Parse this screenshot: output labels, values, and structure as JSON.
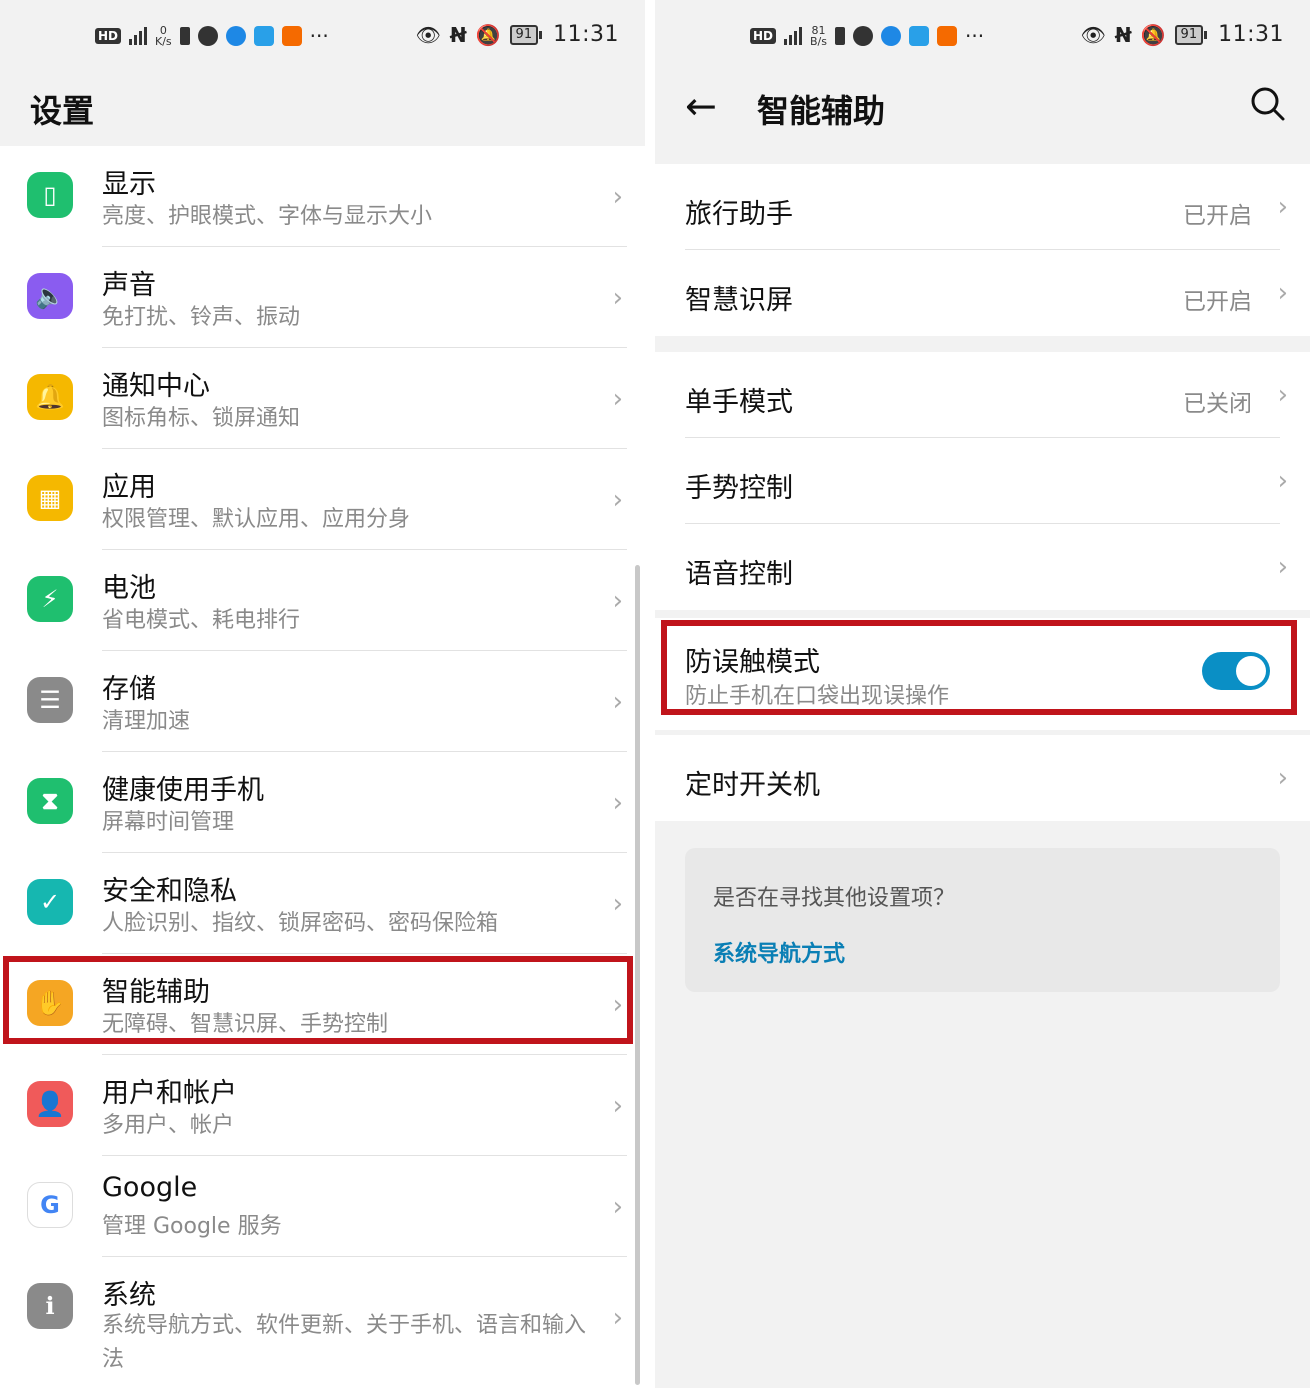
{
  "colors": {
    "accent": "#0a8fc5",
    "highlight": "#c0141b"
  },
  "left": {
    "status": {
      "hd": "HD",
      "net_speed": "0",
      "net_unit": "K/s",
      "battery": "91",
      "time": "11:31"
    },
    "title": "设置",
    "items": [
      {
        "label": "显示",
        "sub": "亮度、护眼模式、字体与显示大小",
        "icon": "display-icon",
        "color": "#1fbf6f"
      },
      {
        "label": "声音",
        "sub": "免打扰、铃声、振动",
        "icon": "speaker-icon",
        "color": "#8a5cf0"
      },
      {
        "label": "通知中心",
        "sub": "图标角标、锁屏通知",
        "icon": "bell-icon",
        "color": "#f5b800"
      },
      {
        "label": "应用",
        "sub": "权限管理、默认应用、应用分身",
        "icon": "apps-grid-icon",
        "color": "#f5b800"
      },
      {
        "label": "电池",
        "sub": "省电模式、耗电排行",
        "icon": "battery-icon",
        "color": "#1fbf6f"
      },
      {
        "label": "存储",
        "sub": "清理加速",
        "icon": "storage-icon",
        "color": "#8a8a8a"
      },
      {
        "label": "健康使用手机",
        "sub": "屏幕时间管理",
        "icon": "hourglass-icon",
        "color": "#1fbf6f"
      },
      {
        "label": "安全和隐私",
        "sub": "人脸识别、指纹、锁屏密码、密码保险箱",
        "icon": "shield-icon",
        "color": "#16b7b0"
      },
      {
        "label": "智能辅助",
        "sub": "无障碍、智慧识屏、手势控制",
        "icon": "hand-icon",
        "color": "#f5a623"
      },
      {
        "label": "用户和帐户",
        "sub": "多用户、帐户",
        "icon": "user-icon",
        "color": "#f05a5a"
      },
      {
        "label": "Google",
        "sub": "管理 Google 服务",
        "icon": "google-icon",
        "color": "#ffffff"
      },
      {
        "label": "系统",
        "sub": "系统导航方式、软件更新、关于手机、语言和输入法",
        "icon": "phone-info-icon",
        "color": "#8a8a8a"
      }
    ]
  },
  "right": {
    "status": {
      "hd": "HD",
      "net_speed": "81",
      "net_unit": "B/s",
      "battery": "91",
      "time": "11:31"
    },
    "title": "智能辅助",
    "group1": [
      {
        "label": "旅行助手",
        "value": "已开启"
      },
      {
        "label": "智慧识屏",
        "value": "已开启"
      }
    ],
    "group2": [
      {
        "label": "单手模式",
        "value": "已关闭"
      },
      {
        "label": "手势控制"
      },
      {
        "label": "语音控制"
      }
    ],
    "toggle_item": {
      "label": "防误触模式",
      "sub": "防止手机在口袋出现误操作",
      "on": true
    },
    "group4": [
      {
        "label": "定时开关机"
      }
    ],
    "suggest": {
      "question": "是否在寻找其他设置项？",
      "link": "系统导航方式"
    }
  }
}
